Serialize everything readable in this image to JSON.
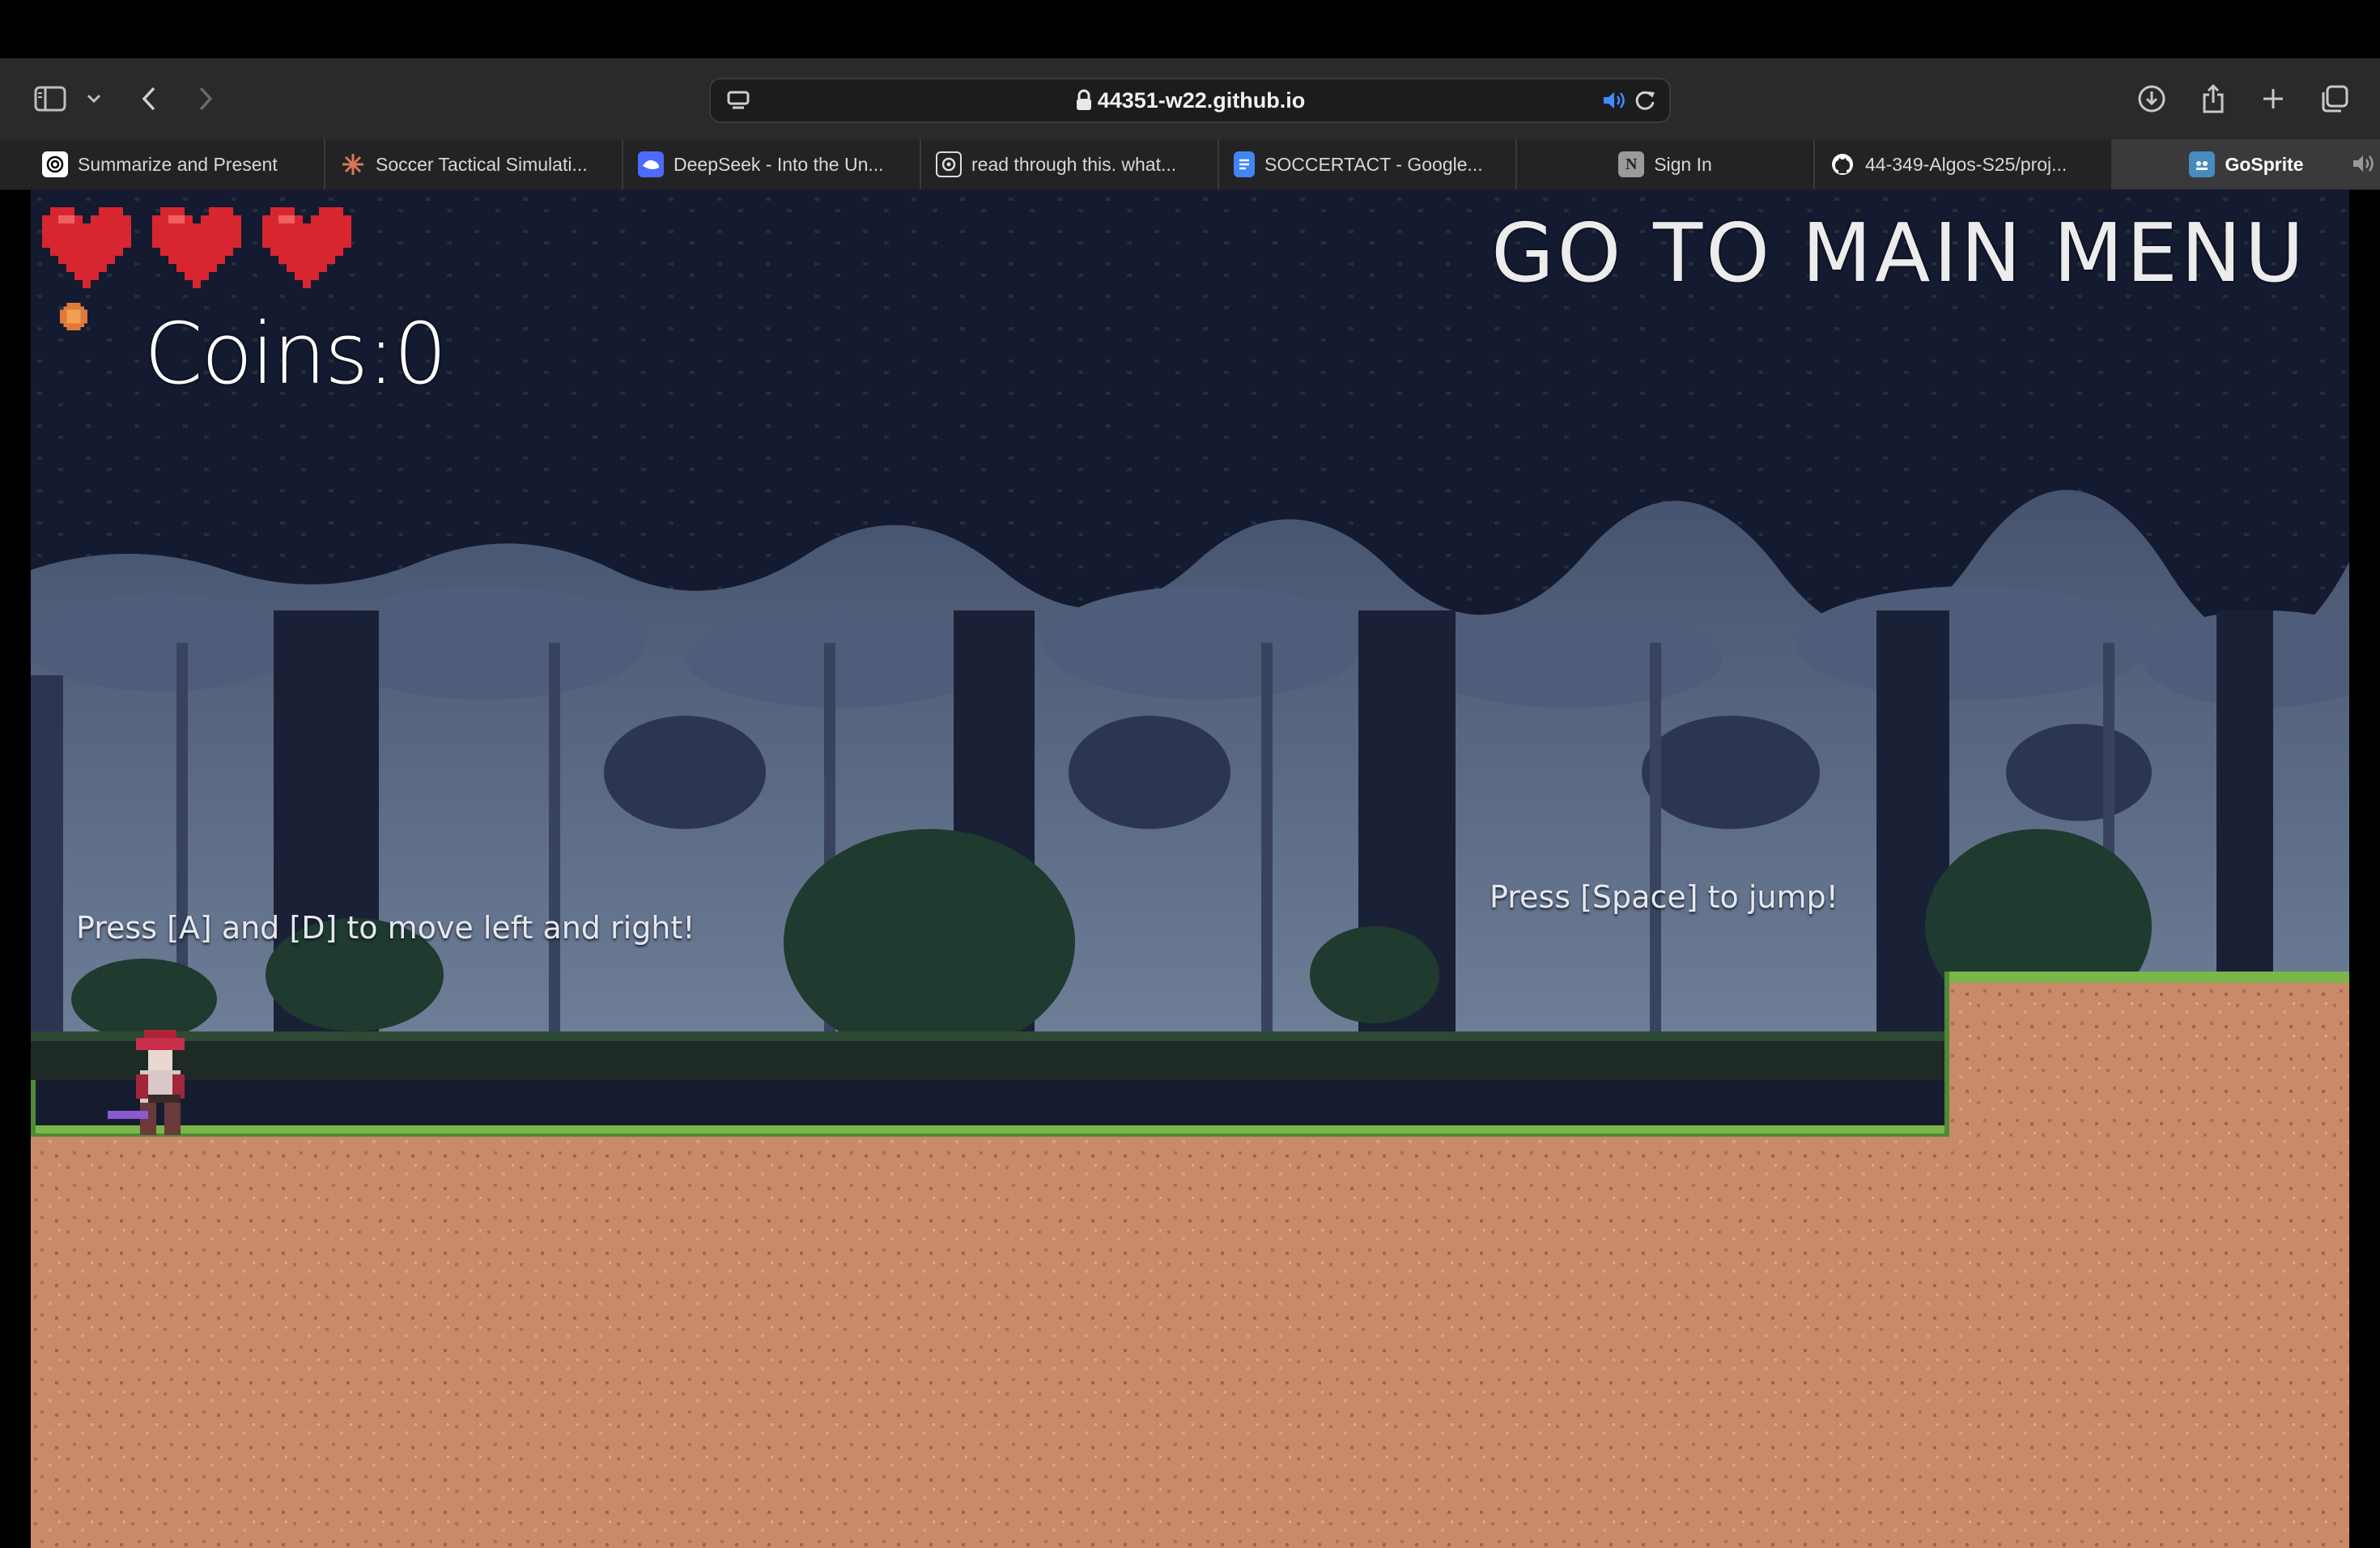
{
  "browser": {
    "url": "44351-w22.github.io",
    "tabs": [
      {
        "title": "Summarize and Present",
        "icon": "openai-icon",
        "color": "#ffffff"
      },
      {
        "title": "Soccer Tactical Simulati...",
        "icon": "claude-sparkle-icon",
        "color": "#d97757"
      },
      {
        "title": "DeepSeek - Into the Un...",
        "icon": "deepseek-icon",
        "color": "#4d6bfe"
      },
      {
        "title": "read through this. what...",
        "icon": "chatgpt-icon",
        "color": "#ffffff"
      },
      {
        "title": "SOCCERTACT - Google...",
        "icon": "google-docs-icon",
        "color": "#4285f4"
      },
      {
        "title": "Sign In",
        "icon": "notion-icon",
        "color": "#9a9a9a"
      },
      {
        "title": "44-349-Algos-S25/proj...",
        "icon": "github-icon",
        "color": "#ffffff"
      },
      {
        "title": "GoSprite",
        "icon": "godot-icon",
        "color": "#478cbf"
      }
    ],
    "active_tab_index": 7
  },
  "game": {
    "hearts": 3,
    "coins_label": "Coins:0",
    "menu_button": "GO TO MAIN MENU",
    "hint_move": "Press [A] and [D] to move left and right!",
    "hint_jump": "Press [Space] to jump!",
    "colors": {
      "sky": "#141a30",
      "forest_far": "#5a6a86",
      "forest_mid": "#323d58",
      "grass": "#7ab648",
      "dirt": "#c98a6a",
      "heart": "#d7262f"
    }
  }
}
